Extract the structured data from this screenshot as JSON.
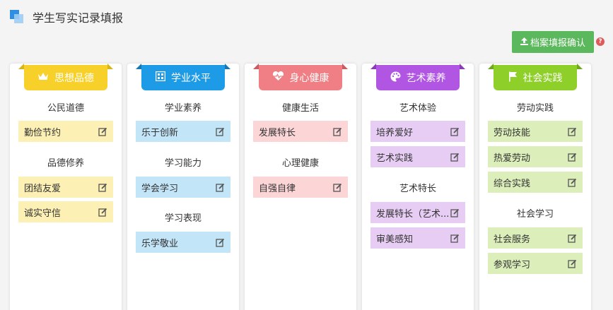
{
  "page": {
    "title": "学生写实记录填报"
  },
  "toolbar": {
    "confirm_label": "档案填报确认",
    "help_glyph": "?"
  },
  "columns": [
    {
      "title": "思想品德",
      "icon": "crown-icon",
      "groups": [
        {
          "title": "公民道德",
          "items": [
            "勤俭节约"
          ]
        },
        {
          "title": "品德修养",
          "items": [
            "团结友爱",
            "诚实守信"
          ]
        }
      ]
    },
    {
      "title": "学业水平",
      "icon": "grid-icon",
      "groups": [
        {
          "title": "学业素养",
          "items": [
            "乐于创新"
          ]
        },
        {
          "title": "学习能力",
          "items": [
            "学会学习"
          ]
        },
        {
          "title": "学习表现",
          "items": [
            "乐学敬业"
          ]
        }
      ]
    },
    {
      "title": "身心健康",
      "icon": "heartbeat-icon",
      "groups": [
        {
          "title": "健康生活",
          "items": [
            "发展特长"
          ]
        },
        {
          "title": "心理健康",
          "items": [
            "自强自律"
          ]
        }
      ]
    },
    {
      "title": "艺术素养",
      "icon": "palette-icon",
      "groups": [
        {
          "title": "艺术体验",
          "items": [
            "培养爱好",
            "艺术实践"
          ]
        },
        {
          "title": "艺术特长",
          "items": [
            "发展特长（艺术...",
            "审美感知"
          ]
        }
      ]
    },
    {
      "title": "社会实践",
      "icon": "flag-icon",
      "groups": [
        {
          "title": "劳动实践",
          "items": [
            "劳动技能",
            "热爱劳动",
            "综合实践"
          ]
        },
        {
          "title": "社会学习",
          "items": [
            "社会服务",
            "参观学习"
          ]
        }
      ]
    }
  ],
  "colors": {
    "yellow": "#f7d02a",
    "blue": "#1e9be6",
    "pink": "#f07f85",
    "purple": "#b155e3",
    "green": "#8fcf2a",
    "confirm": "#5cb85c"
  }
}
